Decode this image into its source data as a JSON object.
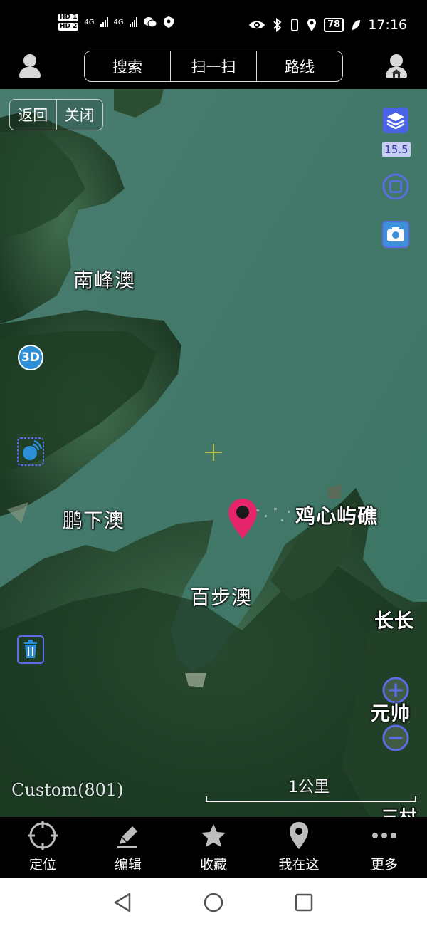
{
  "status_bar": {
    "hd1": "HD 1",
    "hd2": "HD 2",
    "net1": "4G",
    "net2": "4G",
    "battery": "78",
    "time": "17:16"
  },
  "top_nav": {
    "tabs": [
      "搜索",
      "扫一扫",
      "路线"
    ]
  },
  "map": {
    "nav_buttons": {
      "back": "返回",
      "close": "关闭"
    },
    "zoom_level": "15.5",
    "labels": {
      "nanfeng": "南峰澳",
      "pengxia": "鹏下澳",
      "baibu": "百步澳",
      "jixin": "鸡心屿礁",
      "changchang": "长长",
      "yuanshuai": "元帅",
      "bottom_right": "三村"
    },
    "badge_3d": "3D",
    "watermark": "Custom(801)",
    "scale": "1公里"
  },
  "toolbar": {
    "items": [
      {
        "label": "定位",
        "icon": "locate-icon"
      },
      {
        "label": "编辑",
        "icon": "pencil-icon"
      },
      {
        "label": "收藏",
        "icon": "star-icon"
      },
      {
        "label": "我在这",
        "icon": "pin-icon"
      },
      {
        "label": "更多",
        "icon": "more-icon"
      }
    ]
  },
  "colors": {
    "water": "#3d7867",
    "land": "#1f3f25",
    "pin": "#e6246b",
    "control_blue": "#4a63e6"
  }
}
